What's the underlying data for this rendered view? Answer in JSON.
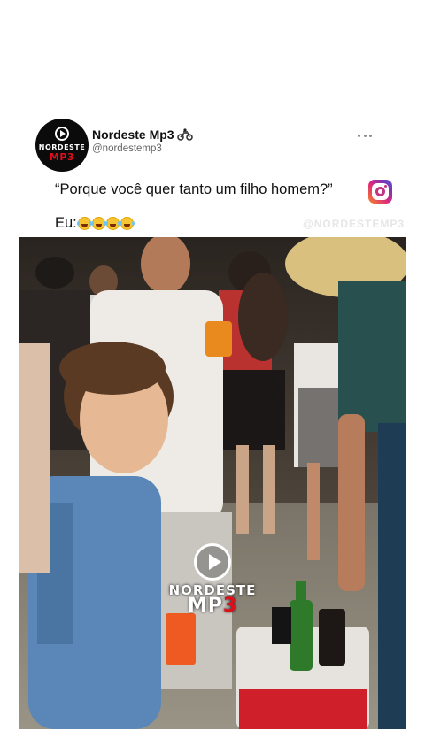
{
  "post": {
    "account_name": "Nordeste Mp3",
    "account_emoji_icon": "motorcycle-icon",
    "handle": "@nordestemp3",
    "avatar_text_top": "NORDESTE",
    "avatar_text_bottom": "MP3",
    "caption": "“Porque você quer tanto um filho homem?”",
    "caption_icon": "instagram-icon",
    "reply_label": "Eu:",
    "reply_emoji_icon": "laughing-tears-emoji-icon",
    "reply_emoji_count": 4,
    "faint_watermark": "@NORDESTEMP3"
  },
  "media": {
    "watermark_top": "NORDESTE",
    "watermark_bottom_a": "MP",
    "watermark_bottom_b": "3"
  },
  "colors": {
    "brand_red": "#e10e1a",
    "text": "#111111",
    "muted": "#666666"
  }
}
